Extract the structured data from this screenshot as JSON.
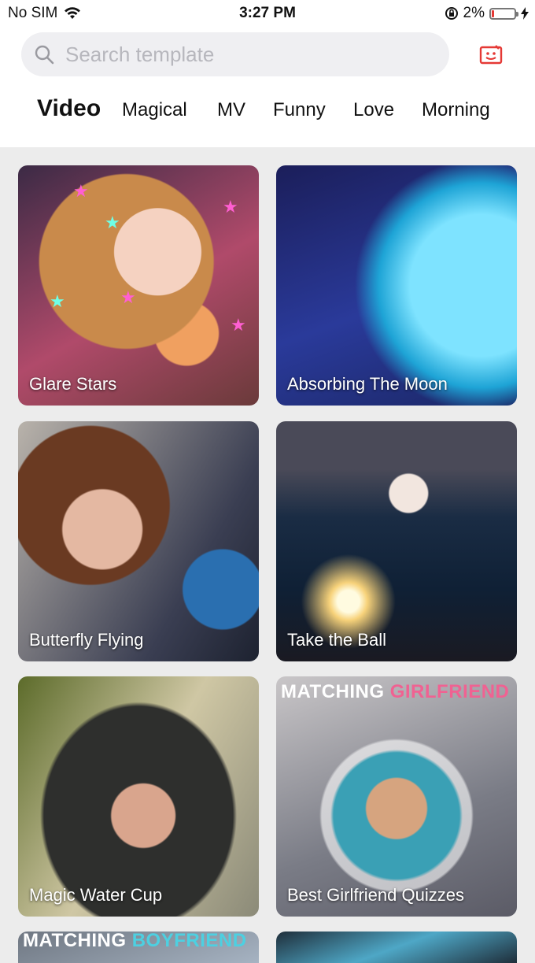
{
  "status_bar": {
    "carrier": "No SIM",
    "time": "3:27 PM",
    "battery_percent": "2%"
  },
  "search": {
    "placeholder": "Search template",
    "value": ""
  },
  "tabs": [
    {
      "label": "Video",
      "active": true
    },
    {
      "label": "Magical",
      "active": false
    },
    {
      "label": "MV",
      "active": false
    },
    {
      "label": "Funny",
      "active": false
    },
    {
      "label": "Love",
      "active": false
    },
    {
      "label": "Morning",
      "active": false
    }
  ],
  "templates": [
    {
      "title": "Glare Stars"
    },
    {
      "title": "Absorbing The Moon"
    },
    {
      "title": "Butterfly Flying"
    },
    {
      "title": "Take the Ball"
    },
    {
      "title": "Magic Water Cup"
    },
    {
      "title": "Best Girlfriend Quizzes",
      "overlay": {
        "text": "MATCHING",
        "accent": "GIRLFRIEND"
      }
    },
    {
      "title": "",
      "overlay": {
        "text": "MATCHING",
        "accent": "BOYFRIEND"
      }
    },
    {
      "title": ""
    }
  ],
  "colors": {
    "accent_red": "#e53935",
    "girlfriend_pink": "#f06292",
    "boyfriend_cyan": "#4dd0e1"
  },
  "icons": {
    "search": "search-icon",
    "feedback": "feedback-icon",
    "wifi": "wifi-icon",
    "rotation_lock": "rotation-lock-icon",
    "battery": "battery-icon",
    "charging": "charging-bolt-icon"
  }
}
